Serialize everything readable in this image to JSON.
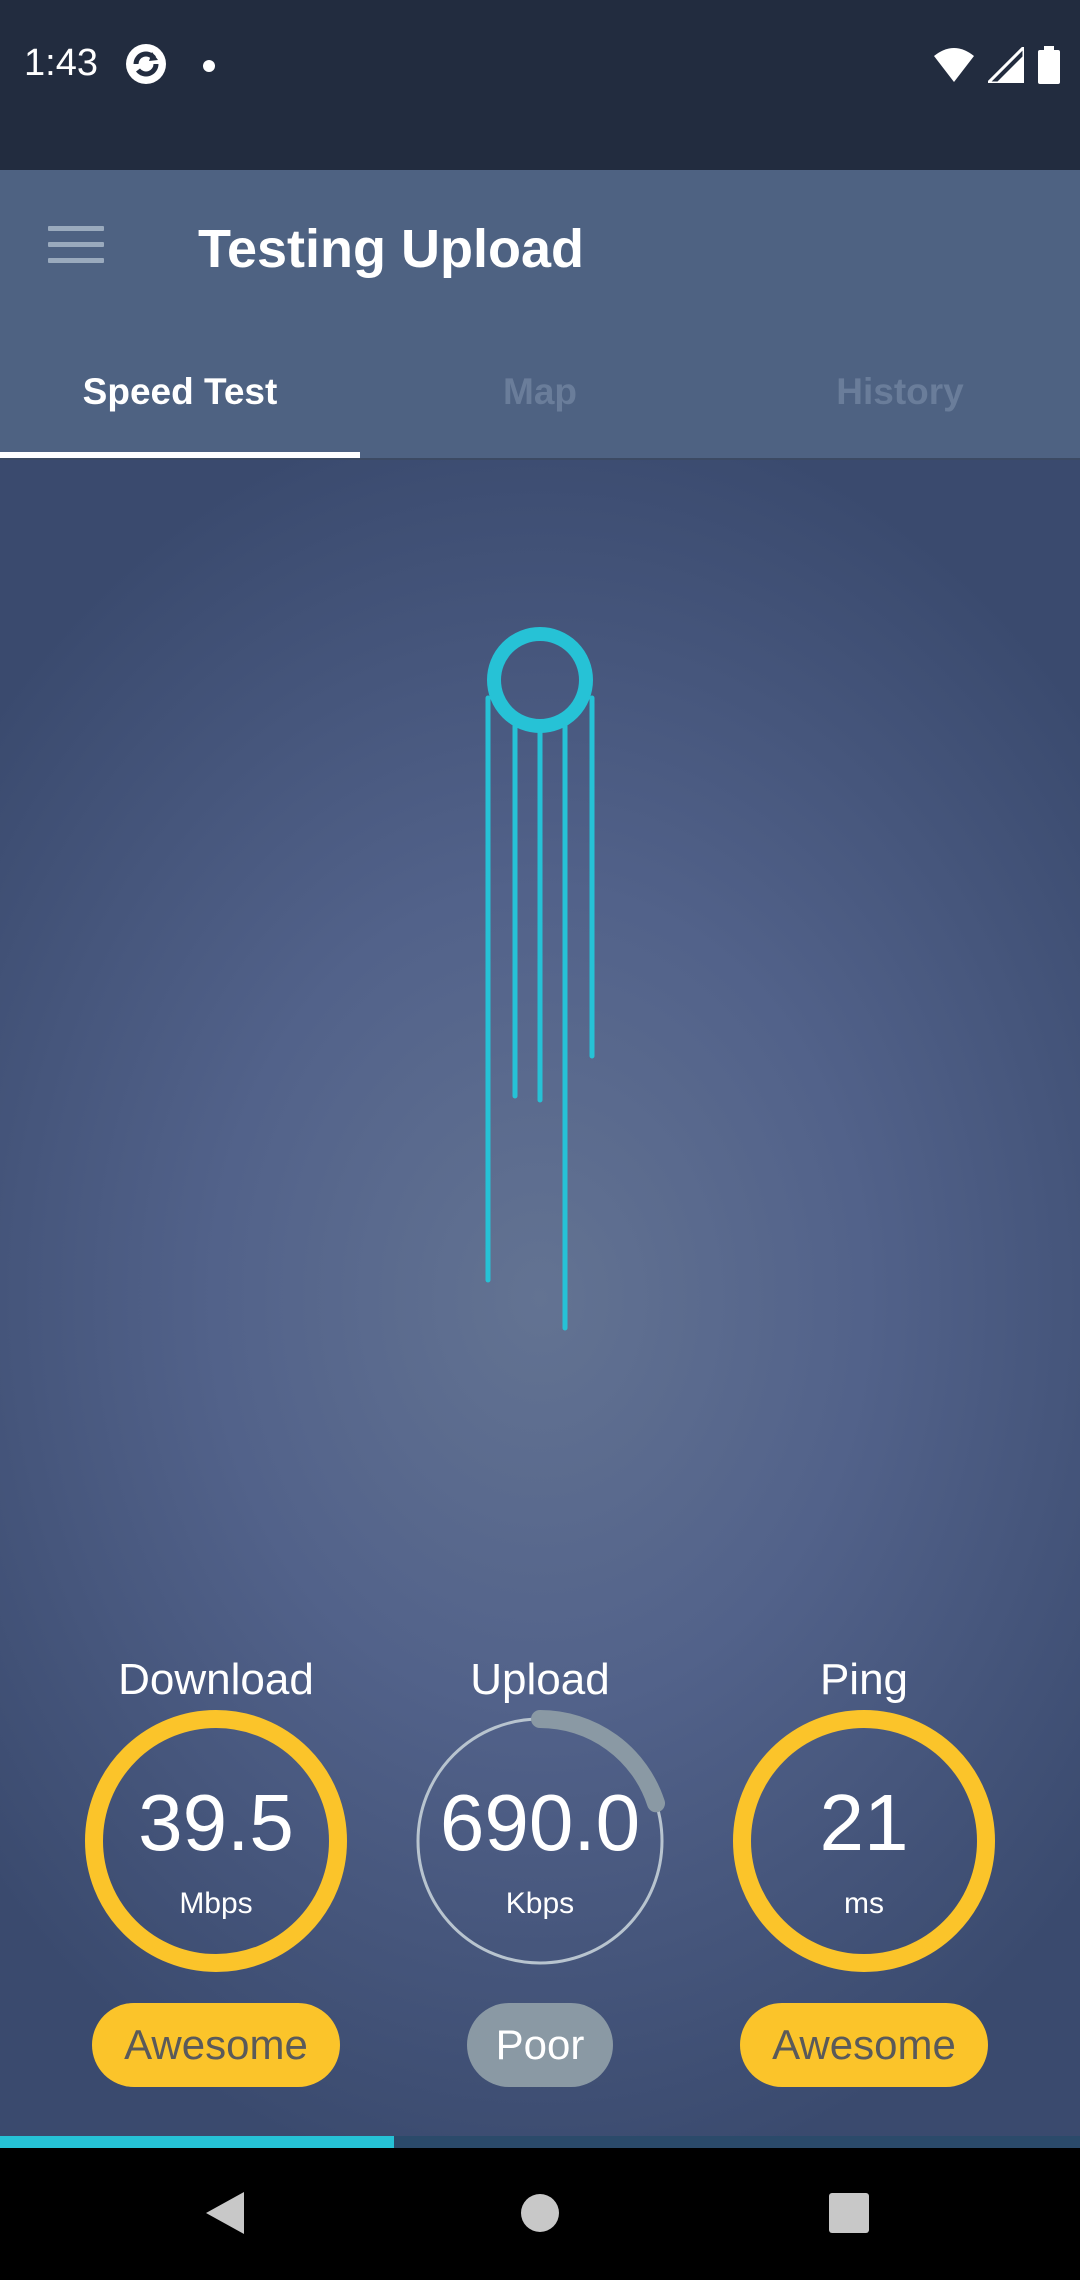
{
  "status_bar": {
    "time": "1:43",
    "icons": [
      "sync-app-icon",
      "notification-dot",
      "wifi-icon",
      "cell-signal-icon",
      "battery-icon"
    ]
  },
  "app_bar": {
    "title": "Testing Upload",
    "menu_icon": "hamburger-menu-icon"
  },
  "tabs": [
    {
      "label": "Speed Test",
      "active": true
    },
    {
      "label": "Map",
      "active": false
    },
    {
      "label": "History",
      "active": false
    }
  ],
  "metrics": {
    "download": {
      "title": "Download",
      "value": "39.5",
      "unit": "Mbps",
      "rating": "Awesome"
    },
    "upload": {
      "title": "Upload",
      "value": "690.0",
      "unit": "Kbps",
      "rating": "Poor",
      "gauge_fraction": 0.2
    },
    "ping": {
      "title": "Ping",
      "value": "21",
      "unit": "ms",
      "rating": "Awesome"
    }
  },
  "test_progress_fraction": 0.365,
  "colors": {
    "accent_cyan": "#26c2d6",
    "good_yellow": "#fbc42a",
    "poor_gray": "#8a99a4",
    "app_bar": "#4e6282",
    "status_bar": "#222c3f"
  },
  "nav_bar": {
    "buttons": [
      "back-icon",
      "home-icon",
      "recents-icon"
    ]
  }
}
